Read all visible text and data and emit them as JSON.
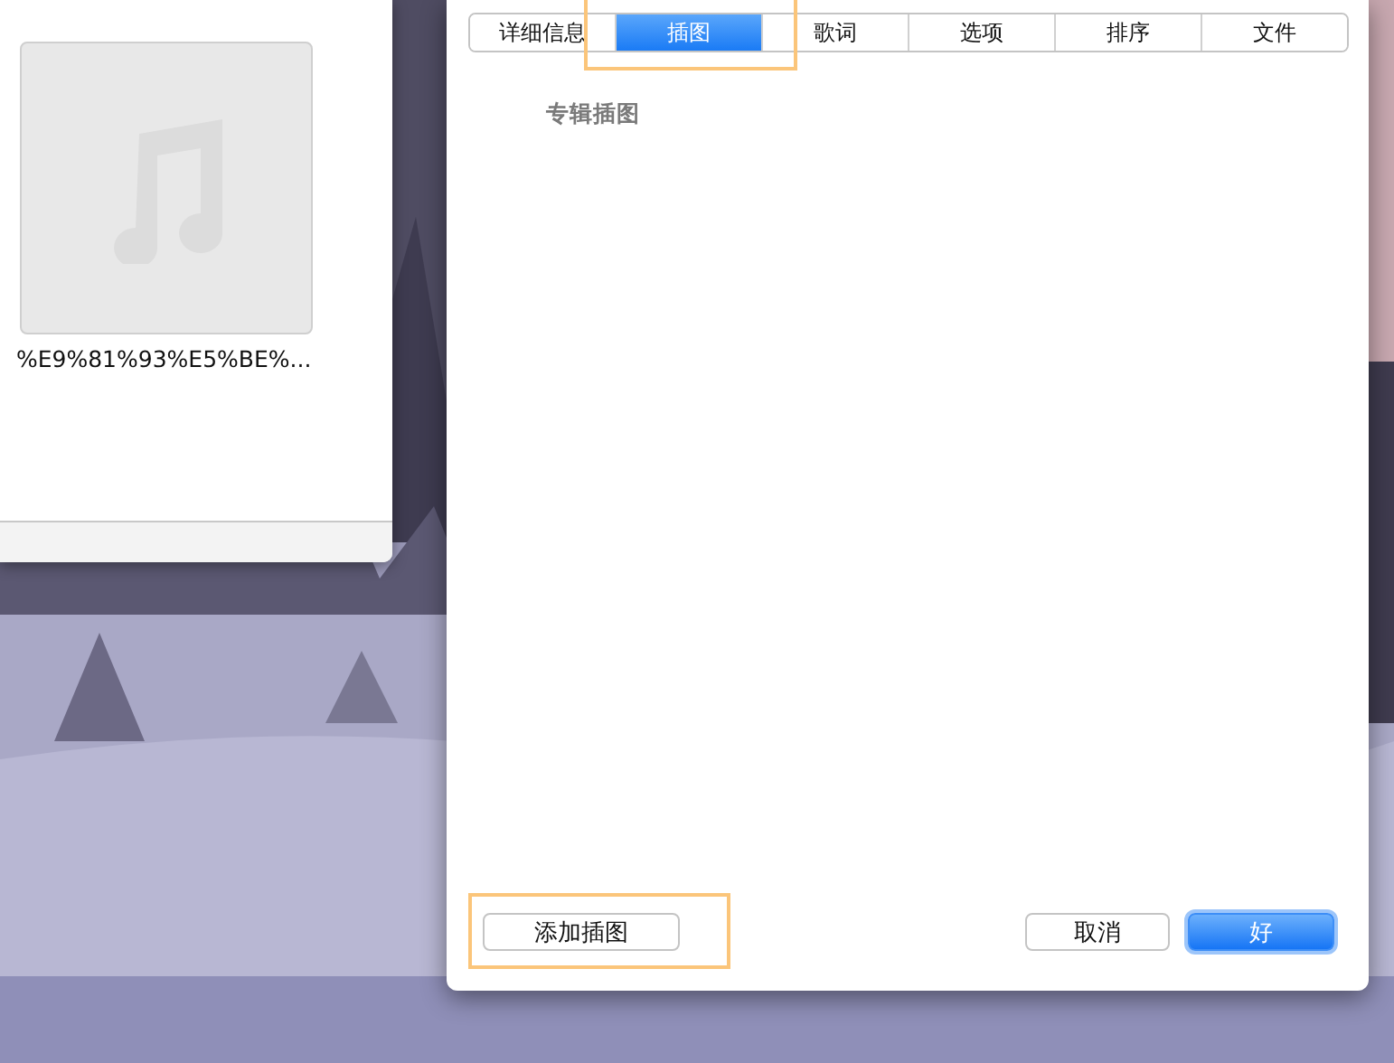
{
  "library_window": {
    "artwork": {
      "kind": "placeholder"
    },
    "file_name": "%E9%81%93%E5%BE%..."
  },
  "dialog": {
    "tabs": [
      {
        "label": "详细信息",
        "selected": false
      },
      {
        "label": "插图",
        "selected": true
      },
      {
        "label": "歌词",
        "selected": false
      },
      {
        "label": "选项",
        "selected": false
      },
      {
        "label": "排序",
        "selected": false
      },
      {
        "label": "文件",
        "selected": false
      }
    ],
    "section_label": "专辑插图",
    "buttons": [
      {
        "label": "添加插图",
        "kind": "secondary",
        "highlighted": true
      },
      {
        "label": "取消",
        "kind": "secondary",
        "highlighted": false
      },
      {
        "label": "好",
        "kind": "default",
        "highlighted": false
      }
    ],
    "highlighted_tab": true
  }
}
